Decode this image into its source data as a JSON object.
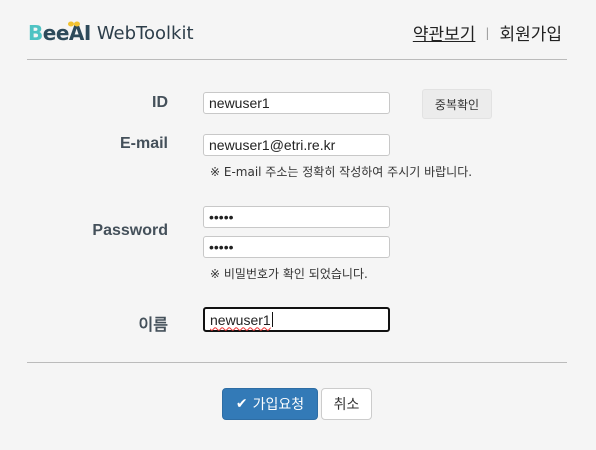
{
  "header": {
    "logo": {
      "b": "B",
      "ee": "ee",
      "ai": "AI",
      "text": "WebToolkit"
    },
    "nav": {
      "terms": "약관보기",
      "separator": "|",
      "signup": "회원가입"
    }
  },
  "form": {
    "id": {
      "label": "ID",
      "value": "newuser1",
      "check_button": "중복확인"
    },
    "email": {
      "label": "E-mail",
      "value": "newuser1@etri.re.kr",
      "help": "※ E-mail 주소는 정확히 작성하여 주시기 바랍니다."
    },
    "password": {
      "label": "Password",
      "value": "•••••",
      "confirm_value": "•••••",
      "help": "※ 비밀번호가 확인 되었습니다."
    },
    "name": {
      "label": "이름",
      "value": "newuser1"
    }
  },
  "actions": {
    "submit": "가입요청",
    "cancel": "취소"
  },
  "colors": {
    "primary": "#337ab7",
    "logo_accent": "#4fc3c3",
    "logo_dark": "#2d4a5a"
  }
}
